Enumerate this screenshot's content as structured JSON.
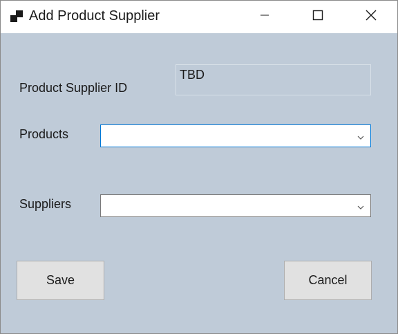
{
  "window": {
    "title": "Add Product Supplier"
  },
  "form": {
    "product_supplier_id_label": "Product Supplier ID",
    "product_supplier_id_value": "TBD",
    "products_label": "Products",
    "products_value": "",
    "suppliers_label": "Suppliers",
    "suppliers_value": ""
  },
  "buttons": {
    "save_label": "Save",
    "cancel_label": "Cancel"
  },
  "colors": {
    "form_background": "#bfcbd8",
    "focus_border": "#0078d7",
    "button_face": "#e1e1e1"
  },
  "icons": {
    "app": "window-app-icon",
    "minimize": "minimize-icon",
    "maximize": "maximize-icon",
    "close": "close-icon",
    "dropdown": "chevron-down-icon"
  }
}
